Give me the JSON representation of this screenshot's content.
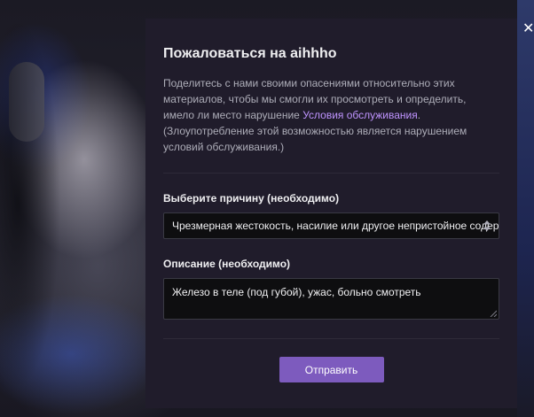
{
  "modal": {
    "title": "Пожаловаться на aihhho",
    "description_part1": "Поделитесь с нами своими опасениями относительно этих материалов, чтобы мы смогли их просмотреть и определить, имело ли место нарушение ",
    "tos_link": "Условия обслуживания",
    "description_part2": ". (Злоупотребление этой возможностью является нарушением условий обслуживания.)",
    "reason_label": "Выберите причину (необходимо)",
    "reason_selected": "Чрезмерная жестокость, насилие или другое непристойное содержание",
    "description_label": "Описание (необходимо)",
    "description_value": "Железо в теле (под губой), ужас, больно смотреть",
    "submit_label": "Отправить",
    "close_icon": "close-icon"
  },
  "colors": {
    "modal_bg": "#201c2b",
    "accent": "#7d5bbe",
    "link": "#bf94ff",
    "input_bg": "#0e0e10"
  }
}
